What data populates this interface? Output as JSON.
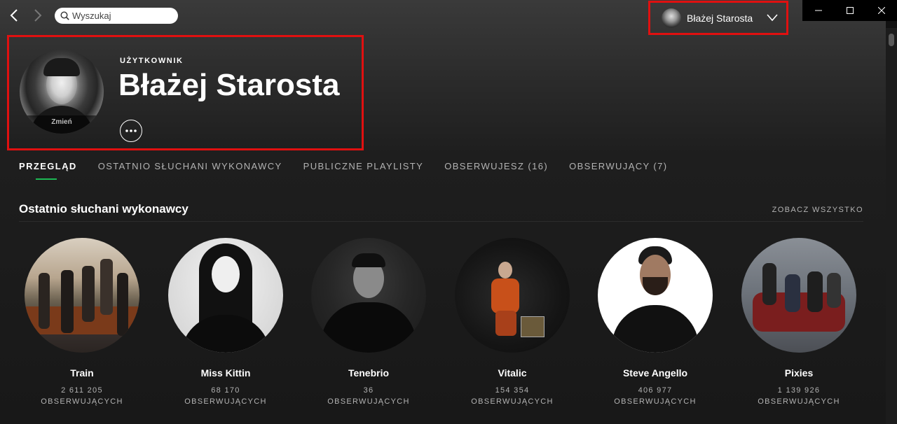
{
  "nav": {
    "search_placeholder": "Wyszukaj"
  },
  "user_menu": {
    "name": "Błażej Starosta"
  },
  "profile": {
    "kind": "UŻYTKOWNIK",
    "name": "Błażej Starosta",
    "avatar_change_label": "Zmień"
  },
  "tabs": [
    {
      "label": "PRZEGLĄD",
      "active": true
    },
    {
      "label": "OSTATNIO SŁUCHANI WYKONAWCY",
      "active": false
    },
    {
      "label": "PUBLICZNE PLAYLISTY",
      "active": false
    },
    {
      "label": "OBSERWUJESZ (16)",
      "active": false
    },
    {
      "label": "OBSERWUJĄCY (7)",
      "active": false
    }
  ],
  "section": {
    "title": "Ostatnio słuchani wykonawcy",
    "see_all": "ZOBACZ WSZYSTKO"
  },
  "artists": [
    {
      "name": "Train",
      "followers": "2 611 205 OBSERWUJĄCYCH"
    },
    {
      "name": "Miss Kittin",
      "followers": "68 170 OBSERWUJĄCYCH"
    },
    {
      "name": "Tenebrio",
      "followers": "36 OBSERWUJĄCYCH"
    },
    {
      "name": "Vitalic",
      "followers": "154 354 OBSERWUJĄCYCH"
    },
    {
      "name": "Steve Angello",
      "followers": "406 977 OBSERWUJĄCYCH"
    },
    {
      "name": "Pixies",
      "followers": "1 139 926 OBSERWUJĄCYCH"
    }
  ],
  "colors": {
    "accent": "#1db954",
    "highlight_border": "#e01010",
    "background": "#121212"
  }
}
